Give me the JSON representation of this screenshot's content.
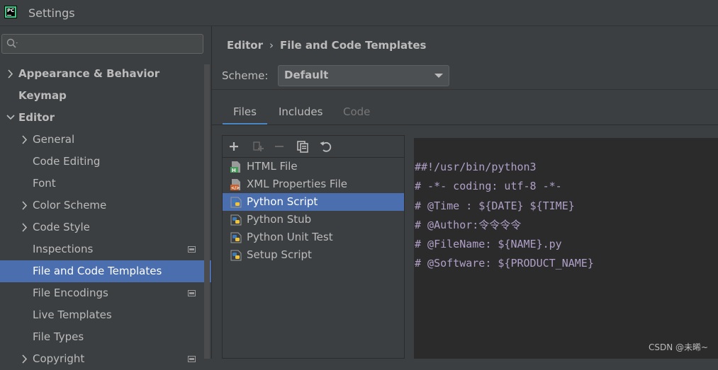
{
  "window": {
    "app_icon_text": "PC",
    "title": "Settings"
  },
  "sidebar": {
    "search_placeholder": "",
    "items": [
      {
        "label": "Appearance & Behavior",
        "bold": true,
        "chevron": "right",
        "indent": 0
      },
      {
        "label": "Keymap",
        "bold": true,
        "chevron": "none",
        "indent": 0
      },
      {
        "label": "Editor",
        "bold": true,
        "chevron": "down",
        "indent": 0
      },
      {
        "label": "General",
        "bold": false,
        "chevron": "right",
        "indent": 1
      },
      {
        "label": "Code Editing",
        "bold": false,
        "chevron": "none",
        "indent": 1
      },
      {
        "label": "Font",
        "bold": false,
        "chevron": "none",
        "indent": 1
      },
      {
        "label": "Color Scheme",
        "bold": false,
        "chevron": "right",
        "indent": 1
      },
      {
        "label": "Code Style",
        "bold": false,
        "chevron": "right",
        "indent": 1
      },
      {
        "label": "Inspections",
        "bold": false,
        "chevron": "none",
        "indent": 1,
        "project_icon": true
      },
      {
        "label": "File and Code Templates",
        "bold": false,
        "chevron": "none",
        "indent": 1,
        "selected": true
      },
      {
        "label": "File Encodings",
        "bold": false,
        "chevron": "none",
        "indent": 1,
        "project_icon": true
      },
      {
        "label": "Live Templates",
        "bold": false,
        "chevron": "none",
        "indent": 1
      },
      {
        "label": "File Types",
        "bold": false,
        "chevron": "none",
        "indent": 1
      },
      {
        "label": "Copyright",
        "bold": false,
        "chevron": "right",
        "indent": 1,
        "project_icon": true
      }
    ]
  },
  "header": {
    "breadcrumb_parent": "Editor",
    "breadcrumb_current": "File and Code Templates"
  },
  "scheme": {
    "label": "Scheme:",
    "value": "Default"
  },
  "tabs": [
    {
      "label": "Files",
      "state": "active"
    },
    {
      "label": "Includes",
      "state": "normal"
    },
    {
      "label": "Code",
      "state": "disabled"
    }
  ],
  "toolbar": {
    "icons": [
      "add-icon",
      "copy-child-icon",
      "remove-icon",
      "duplicate-icon",
      "reset-icon"
    ]
  },
  "files": [
    {
      "label": "HTML File",
      "icon": "html-file-icon"
    },
    {
      "label": "XML Properties File",
      "icon": "xml-file-icon"
    },
    {
      "label": "Python Script",
      "icon": "python-icon",
      "selected": true
    },
    {
      "label": "Python Stub",
      "icon": "python-icon"
    },
    {
      "label": "Python Unit Test",
      "icon": "python-icon"
    },
    {
      "label": "Setup Script",
      "icon": "python-icon"
    }
  ],
  "editor": {
    "lines": [
      "##!/usr/bin/python3",
      "# -*- coding: utf-8 -*-",
      "# @Time : ${DATE} ${TIME}",
      "# @Author:令令令令",
      "# @FileName: ${NAME}.py",
      "# @Software: ${PRODUCT_NAME}"
    ]
  },
  "watermark": "CSDN @未晞~",
  "colors": {
    "background": "#3c3f41",
    "selection": "#4b6eaf",
    "editor_bg": "#2b2b2b",
    "tab_underline": "#4a88c7",
    "code_text": "#b0a0c8"
  }
}
